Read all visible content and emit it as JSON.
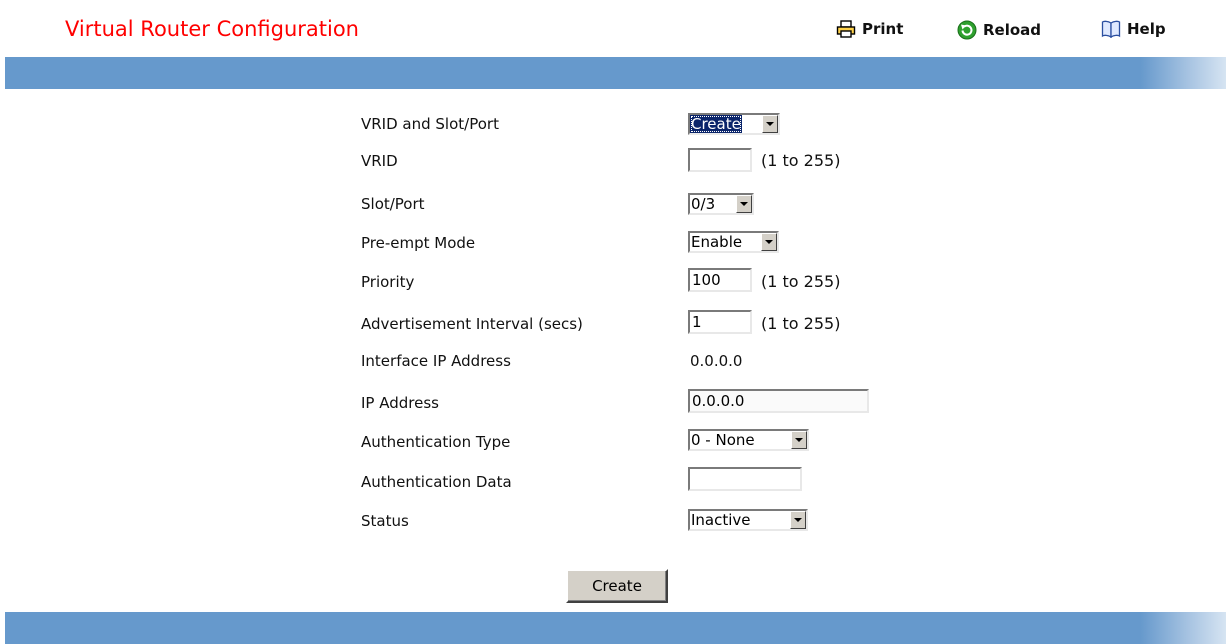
{
  "header": {
    "title": "Virtual Router Configuration",
    "title_color": "#ff0000",
    "actions": [
      {
        "label": "Print",
        "icon": "printer-icon"
      },
      {
        "label": "Reload",
        "icon": "reload-icon"
      },
      {
        "label": "Help",
        "icon": "book-icon"
      }
    ]
  },
  "theme": {
    "bar_color": "#6699cc"
  },
  "form": {
    "vrid_slot_port": {
      "label": "VRID and Slot/Port",
      "selected": "Create"
    },
    "vrid": {
      "label": "VRID",
      "value": "",
      "hint": "(1 to 255)"
    },
    "slot_port": {
      "label": "Slot/Port",
      "selected": "0/3"
    },
    "preempt_mode": {
      "label": "Pre-empt Mode",
      "selected": "Enable"
    },
    "priority": {
      "label": "Priority",
      "value": "100",
      "hint": "(1 to 255)"
    },
    "adv_interval": {
      "label": "Advertisement Interval (secs)",
      "value": "1",
      "hint": "(1 to 255)"
    },
    "interface_ip": {
      "label": "Interface IP Address",
      "value": "0.0.0.0"
    },
    "ip_address": {
      "label": "IP Address",
      "value": "0.0.0.0"
    },
    "auth_type": {
      "label": "Authentication Type",
      "selected": "0 - None"
    },
    "auth_data": {
      "label": "Authentication Data",
      "value": ""
    },
    "status": {
      "label": "Status",
      "selected": "Inactive"
    },
    "submit_label": "Create"
  }
}
